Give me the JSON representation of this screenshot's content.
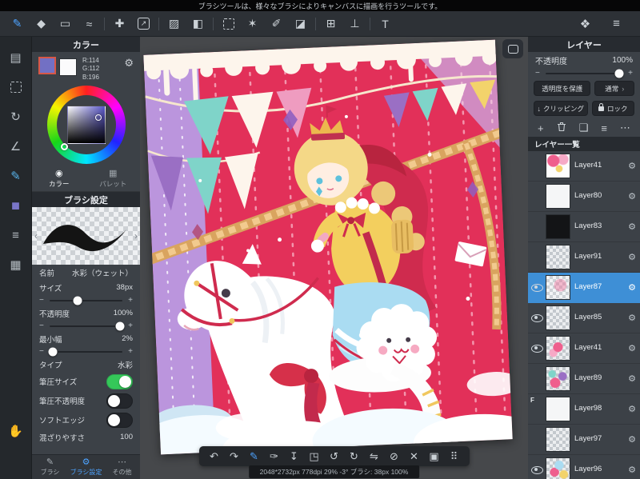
{
  "colors": {
    "accent_blue": "#4da3ff",
    "toggle_on": "#35c759",
    "selected_layer_blue": "#3e8fd6",
    "current_color": "#7270c4",
    "canvas_pink": "#e23059"
  },
  "glyphs": {
    "gear": "⚙",
    "minus": "−",
    "plus": "+",
    "chevron": "›",
    "add": "+",
    "duplicate": "❏",
    "list": "≡",
    "more": "⋯",
    "clip": "↓",
    "prev": "‹",
    "next": "›"
  },
  "top_hint": "ブラシツールは、様々なブラシによりキャンバスに描画を行うツールです。",
  "main_toolbar": {
    "left_icons": [
      {
        "name": "brush-tool",
        "glyph": "✎",
        "active": true
      },
      {
        "name": "eraser-tool",
        "glyph": "◆"
      },
      {
        "name": "rect-tool",
        "glyph": "▭"
      },
      {
        "name": "curve-tool",
        "glyph": "≈"
      },
      {
        "name": "divider",
        "cls": "divider",
        "interactable": false
      },
      {
        "name": "move-tool",
        "glyph": "✚"
      },
      {
        "name": "export-tool",
        "glyph": "↗",
        "cls": "boxed"
      },
      {
        "name": "divider",
        "cls": "divider",
        "interactable": false
      },
      {
        "name": "fill-tool",
        "glyph": "▨"
      },
      {
        "name": "bucket-tool",
        "glyph": "◧"
      },
      {
        "name": "divider",
        "cls": "divider",
        "interactable": false
      },
      {
        "name": "select-tool",
        "cls": "dashed-box"
      },
      {
        "name": "wand-tool",
        "glyph": "✶"
      },
      {
        "name": "select-pen-tool",
        "glyph": "✐"
      },
      {
        "name": "select-eraser-tool",
        "glyph": "◪"
      },
      {
        "name": "divider",
        "cls": "divider",
        "interactable": false
      },
      {
        "name": "snap-grid-tool",
        "glyph": "⊞"
      },
      {
        "name": "snap-perspective-tool",
        "glyph": "⊥"
      },
      {
        "name": "divider",
        "cls": "divider",
        "interactable": false
      },
      {
        "name": "text-tool",
        "glyph": "T"
      }
    ],
    "right_icons": [
      {
        "name": "community-icon",
        "glyph": "❖"
      },
      {
        "name": "panel-layout-icon",
        "glyph": "≡"
      }
    ]
  },
  "left_rail": {
    "top_icons": [
      {
        "name": "canvas-menu-icon",
        "glyph": "▤"
      },
      {
        "name": "selection-panel-icon",
        "cls": "dashed-box"
      },
      {
        "name": "transform-panel-icon",
        "glyph": "↻"
      },
      {
        "name": "ruler-panel-icon",
        "glyph": "∠"
      },
      {
        "name": "brush-panel-icon",
        "glyph": "✎",
        "cls": "tint-blue"
      },
      {
        "name": "color-panel-icon",
        "glyph": "■",
        "cls": "tint-swatch"
      },
      {
        "name": "layer-panel-icon",
        "glyph": "≡"
      },
      {
        "name": "material-panel-icon",
        "glyph": "▦"
      }
    ],
    "bottom_icons": [
      {
        "name": "hand-tool-icon",
        "glyph": "✋"
      }
    ]
  },
  "color_panel": {
    "title": "カラー",
    "rgb_r": "R:114",
    "rgb_g": "G:112",
    "rgb_b": "B:196",
    "tabs": [
      {
        "name": "tab-color",
        "label": "カラー",
        "glyph": "◉",
        "active": true
      },
      {
        "name": "tab-palette",
        "label": "パレット",
        "glyph": "▦",
        "active": false
      }
    ]
  },
  "brush_panel": {
    "title": "ブラシ設定",
    "name_label": "名前",
    "name_value": "水彩（ウェット）",
    "size_label": "サイズ",
    "size_value": "38px",
    "size_pct": 38,
    "opacity_label": "不透明度",
    "opacity_value": "100%",
    "opacity_pct": 96,
    "minwidth_label": "最小幅",
    "minwidth_value": "2%",
    "minwidth_pct": 5,
    "type_label": "タイプ",
    "type_value": "水彩",
    "pressure_size_label": "筆圧サイズ",
    "pressure_size_on": true,
    "pressure_opacity_label": "筆圧不透明度",
    "pressure_opacity_on": false,
    "soft_edge_label": "ソフトエッジ",
    "soft_edge_on": false,
    "mixing_label": "混ざりやすさ",
    "mixing_value": "100",
    "tabs": [
      {
        "name": "tab-brush",
        "label": "ブラシ",
        "glyph": "✎",
        "active": false
      },
      {
        "name": "tab-brush-settings",
        "label": "ブラシ設定",
        "glyph": "⚙",
        "active": true
      },
      {
        "name": "tab-others",
        "label": "その他",
        "glyph": "⋯",
        "active": false
      }
    ]
  },
  "canvas": {
    "status": "2048*2732px 778dpi 29% -3° ブラシ: 38px 100%"
  },
  "bottom_toolbar": [
    {
      "name": "undo-button",
      "glyph": "↶"
    },
    {
      "name": "redo-button",
      "glyph": "↷"
    },
    {
      "name": "brush-cursor-button",
      "glyph": "✎",
      "active": true
    },
    {
      "name": "eyedropper-button",
      "glyph": "✑"
    },
    {
      "name": "save-button",
      "glyph": "↧"
    },
    {
      "name": "transform-button",
      "glyph": "◳"
    },
    {
      "name": "rotate-ccw-button",
      "glyph": "↺"
    },
    {
      "name": "rotate-cw-button",
      "glyph": "↻"
    },
    {
      "name": "flip-button",
      "glyph": "⇋"
    },
    {
      "name": "deselect-button",
      "glyph": "⊘"
    },
    {
      "name": "clear-button",
      "glyph": "✕"
    },
    {
      "name": "material-button",
      "glyph": "▣"
    },
    {
      "name": "drag-handle",
      "glyph": "⠿"
    }
  ],
  "layer_panel": {
    "title": "レイヤー",
    "opacity_label": "不透明度",
    "opacity_value": "100%",
    "opacity_pct": 96,
    "protect_button": "透明度を保護",
    "blend_button": "通常",
    "clipping_button": "クリッピング",
    "lock_button": "ロック",
    "list_title": "レイヤー一覧",
    "layers": [
      {
        "name": "Layer41",
        "thumb": "art-pink",
        "visible": false,
        "selected": false
      },
      {
        "name": "Layer80",
        "thumb": "white",
        "visible": false,
        "selected": false
      },
      {
        "name": "Layer83",
        "thumb": "black",
        "visible": false,
        "selected": false
      },
      {
        "name": "Layer91",
        "thumb": "checker",
        "visible": false,
        "selected": false
      },
      {
        "name": "Layer87",
        "thumb": "checker-light",
        "visible": true,
        "selected": true
      },
      {
        "name": "Layer85",
        "thumb": "checker",
        "visible": true,
        "selected": false
      },
      {
        "name": "Layer41",
        "thumb": "art-pink2",
        "visible": true,
        "selected": false
      },
      {
        "name": "Layer89",
        "thumb": "art-mix",
        "visible": false,
        "selected": false
      },
      {
        "name": "Layer98",
        "thumb": "white",
        "visible": false,
        "selected": false,
        "badge": "F"
      },
      {
        "name": "Layer97",
        "thumb": "checker",
        "visible": false,
        "selected": false
      },
      {
        "name": "Layer96",
        "thumb": "art-mix2",
        "visible": true,
        "selected": false
      }
    ]
  }
}
